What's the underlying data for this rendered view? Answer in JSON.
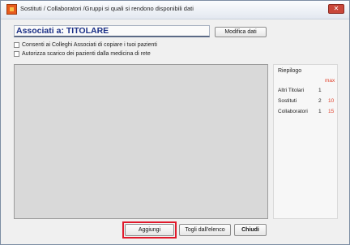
{
  "window": {
    "title": "Sostituti / Collaboratori /Gruppi si quali si rendono disponibili dati",
    "close_label": "✕"
  },
  "header": {
    "title": "Associati a: TITOLARE",
    "modify_button": "Modifica dati"
  },
  "options": [
    {
      "label": "Consenti ai Colleghi Associati di copiare i tuoi pazienti",
      "checked": false
    },
    {
      "label": "Autorizza scarico dei pazienti dalla medicina di rete",
      "checked": false
    }
  ],
  "summary": {
    "title": "Riepilogo",
    "max_label": "max",
    "rows": [
      {
        "label": "Altri Titolari",
        "count": "1",
        "max": ""
      },
      {
        "label": "Sostituti",
        "count": "2",
        "max": "10"
      },
      {
        "label": "Collaboratori",
        "count": "1",
        "max": "15"
      }
    ]
  },
  "footer": {
    "add_button": "Aggiungi",
    "remove_button": "Togli dall'elenco",
    "close_button": "Chiudi"
  },
  "colors": {
    "header_text": "#1a2f86",
    "max_value": "#e0402a",
    "highlight_border": "#e0192b"
  }
}
